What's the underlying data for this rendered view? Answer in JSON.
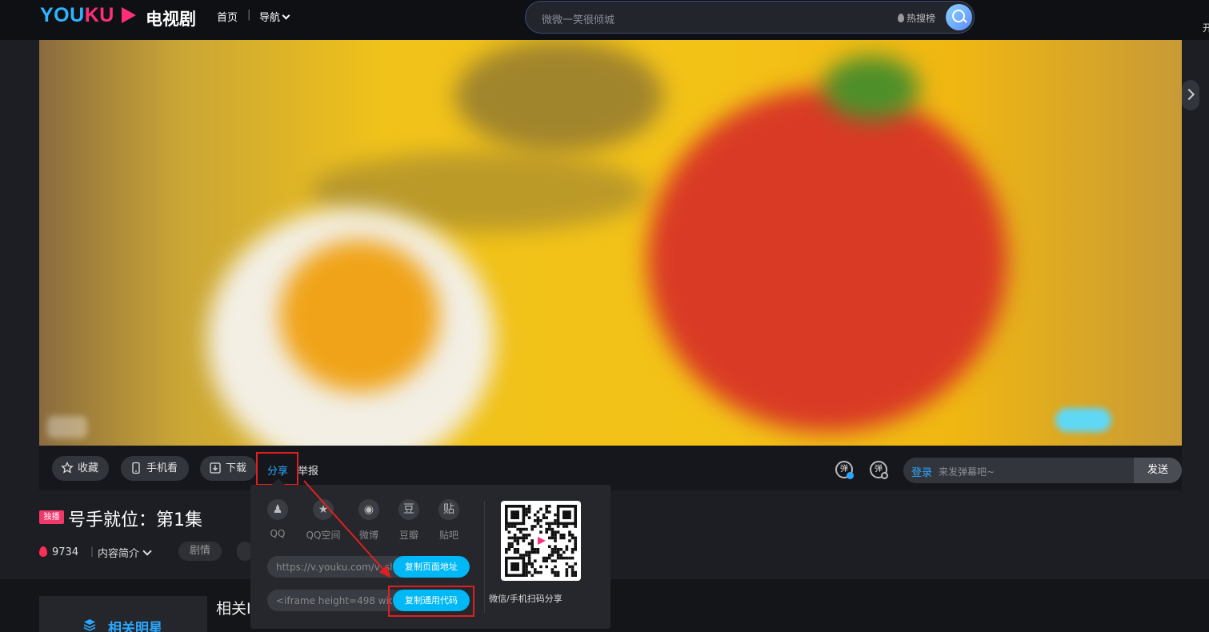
{
  "header": {
    "logo_text_blue": "YOU",
    "logo_text_pink": "KU",
    "channel": "电视剧",
    "nav_home": "首页",
    "nav_separator": "|",
    "nav_menu": "导航",
    "search_placeholder": "微微一笑很倾城",
    "hot_search": "热搜榜",
    "edge_text": "开"
  },
  "player": {
    "description": "blurred video frame"
  },
  "controls": {
    "collect": "收藏",
    "phone_watch": "手机看",
    "download": "下载",
    "share": "分享",
    "report": "举报",
    "danmu_icon_text": "弹",
    "danmu_login": "登录",
    "danmu_placeholder": "来发弹幕吧~",
    "danmu_send": "发送"
  },
  "video_info": {
    "exclusive_badge": "独播",
    "title": "号手就位：第1集",
    "heat": "9734",
    "separator": "|",
    "intro": "内容简介",
    "tags": [
      "剧情",
      ""
    ]
  },
  "share_popup": {
    "platforms": [
      {
        "label": "QQ",
        "icon": "qq-icon",
        "glyph": "♟"
      },
      {
        "label": "QQ空间",
        "icon": "qzone-star-icon",
        "glyph": "★"
      },
      {
        "label": "微博",
        "icon": "weibo-icon",
        "glyph": "◉"
      },
      {
        "label": "豆瓣",
        "icon": "douban-icon",
        "glyph": "豆"
      },
      {
        "label": "贴吧",
        "icon": "tieba-icon",
        "glyph": "贴"
      }
    ],
    "page_url": "https://v.youku.com/v_show",
    "copy_url_button": "复制页面地址",
    "embed_code": "<iframe height=498 width=510",
    "copy_code_button": "复制通用代码",
    "qr_caption": "微信/手机扫码分享"
  },
  "lower": {
    "related_stars": "相关明星",
    "related_heading": "相关I"
  },
  "colors": {
    "accent_blue": "#2aa8ff",
    "brand_pink": "#ff2e7a",
    "annotation_red": "#e02020",
    "copy_button": "#00b8f5"
  }
}
